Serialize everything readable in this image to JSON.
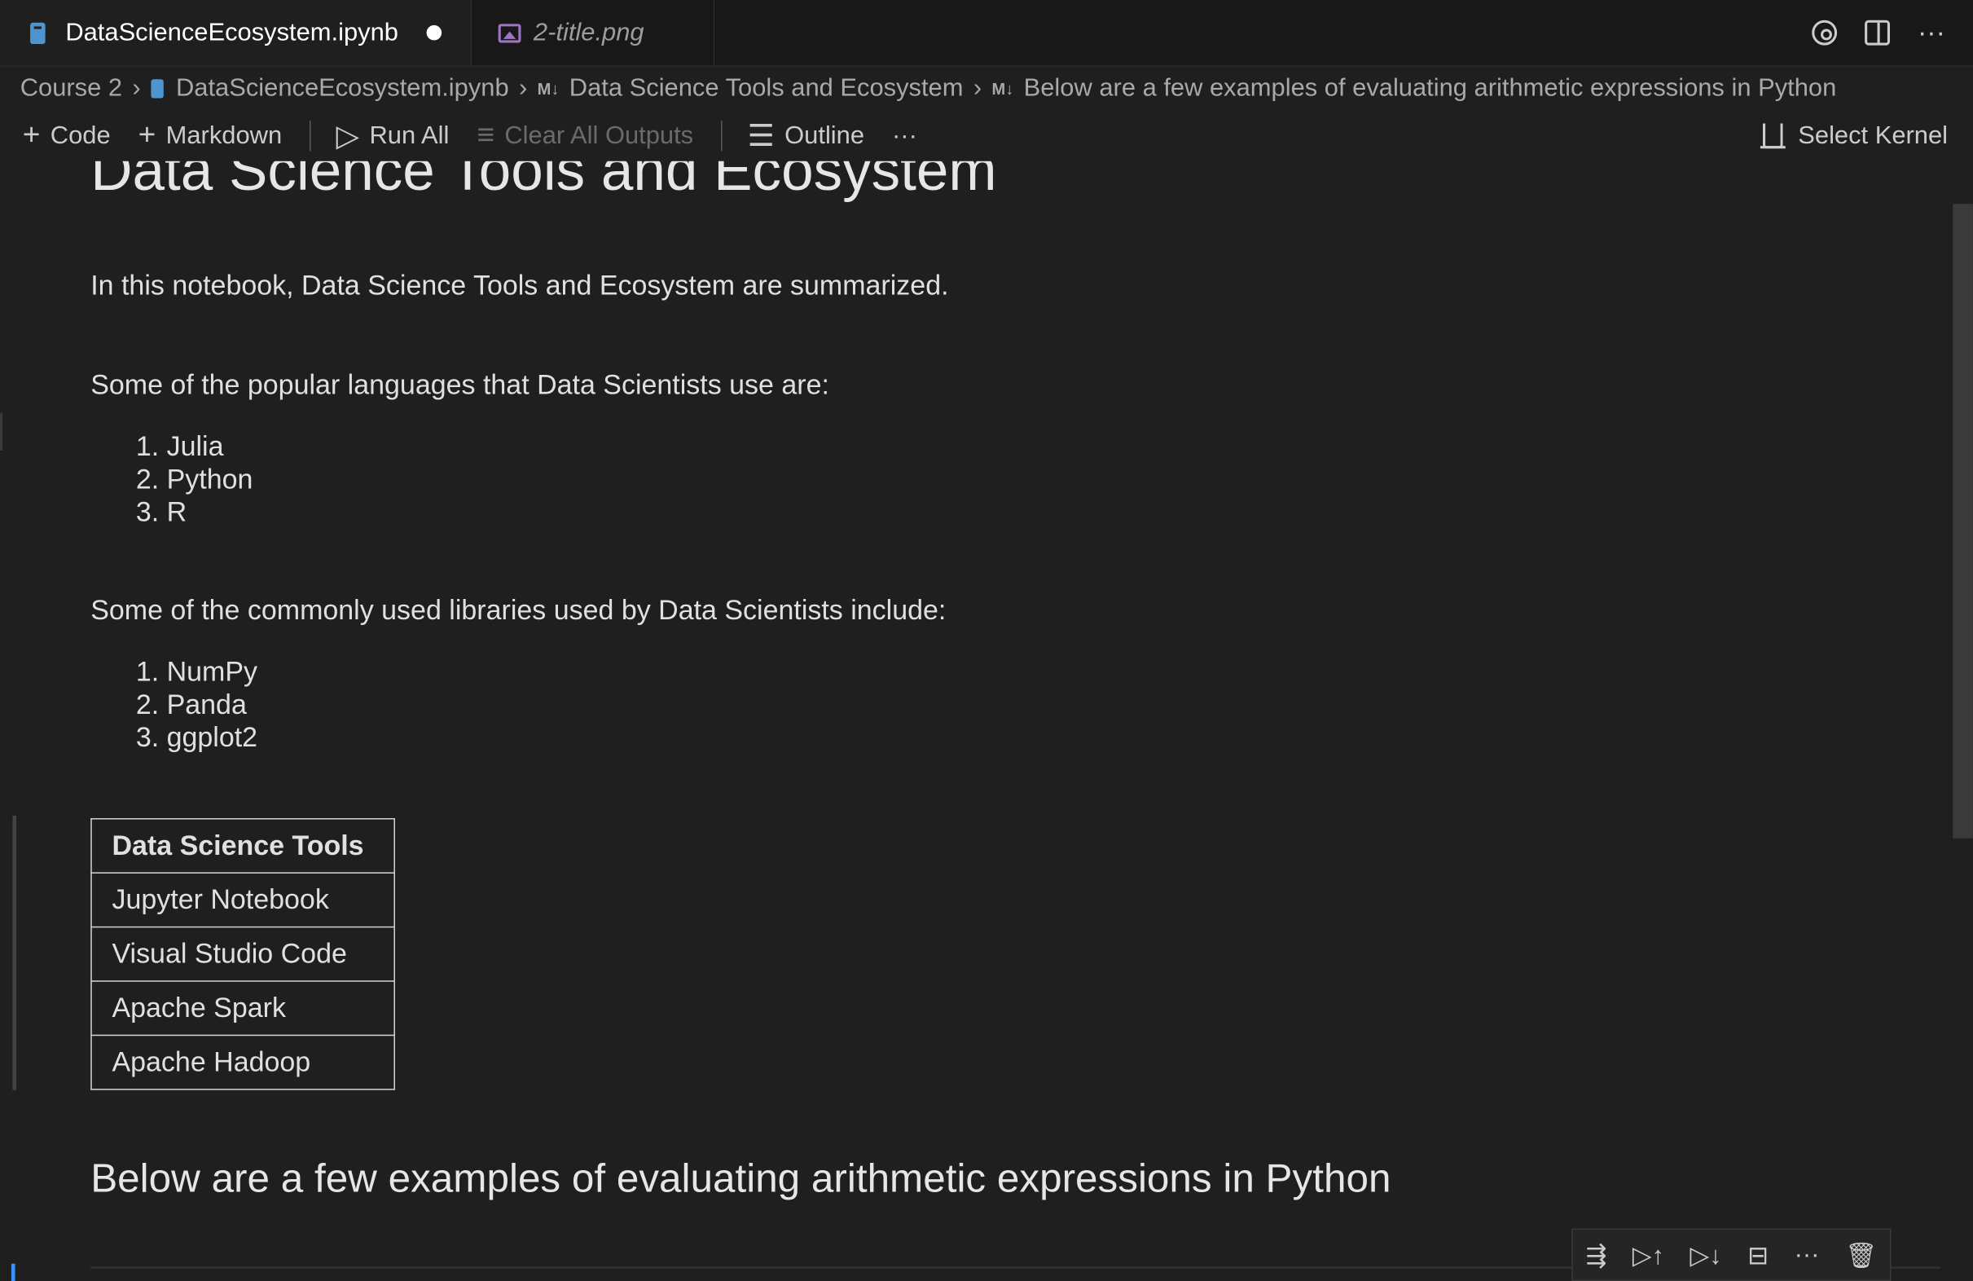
{
  "tabs": [
    {
      "label": "DataScienceEcosystem.ipynb",
      "active": true,
      "dirty": true
    },
    {
      "label": "2-title.png",
      "active": false
    }
  ],
  "breadcrumbs": {
    "folder": "Course 2",
    "file": "DataScienceEcosystem.ipynb",
    "heading1": "Data Science Tools and Ecosystem",
    "heading2": "Below are a few examples of evaluating arithmetic expressions in Python"
  },
  "toolbar": {
    "code": "Code",
    "markdown": "Markdown",
    "run_all": "Run All",
    "clear_outputs": "Clear All Outputs",
    "outline": "Outline",
    "more": "···",
    "select_kernel": "Select Kernel"
  },
  "notebook": {
    "title": "Data Science Tools and Ecosystem",
    "intro": "In this notebook, Data Science Tools and Ecosystem are summarized.",
    "languages_intro": "Some of the popular languages that Data Scientists use are:",
    "languages": [
      "1. Julia",
      "2. Python",
      "3. R"
    ],
    "libraries_intro": "Some of the commonly used libraries used by Data Scientists include:",
    "libraries": [
      "1. NumPy",
      "2. Panda",
      "3. ggplot2"
    ],
    "table_header": "Data Science Tools",
    "table_rows": [
      "Jupyter Notebook",
      "Visual Studio Code",
      "Apache Spark",
      "Apache Hadoop"
    ],
    "arith_heading": "Below are a few examples of evaluating arithmetic expressions in Python"
  },
  "colors": {
    "accent": "#3794ff",
    "notebook_icon": "#4e94ce",
    "image_icon": "#a074c4"
  }
}
